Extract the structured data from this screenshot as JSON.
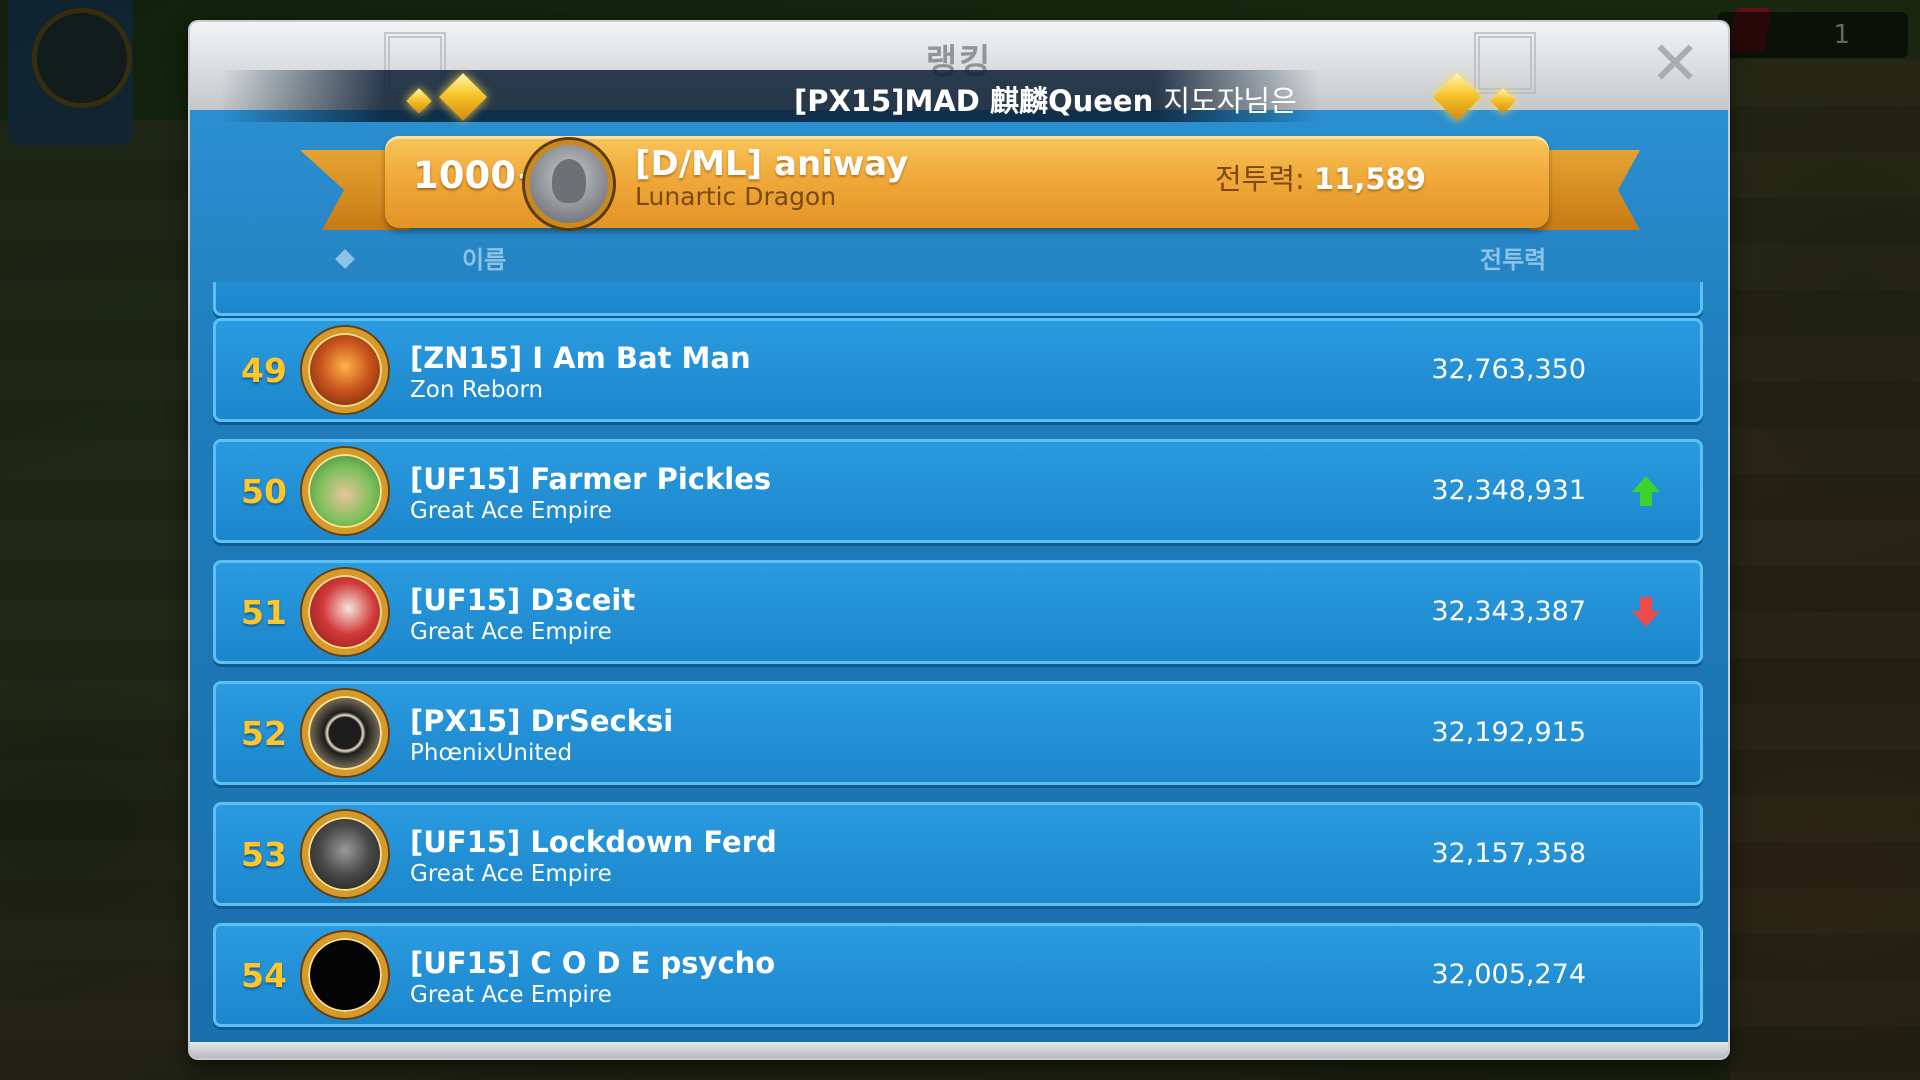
{
  "window": {
    "title": "랭킹"
  },
  "hud": {
    "counter": "1"
  },
  "announcement": {
    "text": "[PX15]MAD 麒麟Queen",
    "suffix": "지도자님은"
  },
  "my_entry": {
    "rank": "1000+",
    "name": "[D/ML] aniway",
    "alliance": "Lunartic Dragon",
    "power_label": "전투력: ",
    "power_value": "11,589"
  },
  "columns": {
    "name": "이름",
    "power": "전투력"
  },
  "rows": [
    {
      "rank": "49",
      "name": "[ZN15] I Am Bat Man",
      "alliance": "Zon Reborn",
      "power": "32,763,350",
      "trend": "none",
      "avatar": "dragon-emblem",
      "color": "#c8541c"
    },
    {
      "rank": "50",
      "name": "[UF15] Farmer Pickles",
      "alliance": "Great Ace Empire",
      "power": "32,348,931",
      "trend": "up",
      "avatar": "farmer-character",
      "color": "#7cbf5a"
    },
    {
      "rank": "51",
      "name": "[UF15] D3ceit",
      "alliance": "Great Ace Empire",
      "power": "32,343,387",
      "trend": "down",
      "avatar": "red-hood-character",
      "color": "#d23a3a"
    },
    {
      "rank": "52",
      "name": "[PX15] DrSecksi",
      "alliance": "PhœnixUnited",
      "power": "32,192,915",
      "trend": "none",
      "avatar": "pentagram-seal",
      "color": "#1c1c1c"
    },
    {
      "rank": "53",
      "name": "[UF15] Lockdown Ferd",
      "alliance": "Great Ace Empire",
      "power": "32,157,358",
      "trend": "none",
      "avatar": "lion-mask",
      "color": "#4a4a4a"
    },
    {
      "rank": "54",
      "name": "[UF15] C O D E psycho",
      "alliance": "Great Ace Empire",
      "power": "32,005,274",
      "trend": "none",
      "avatar": "black-circle",
      "color": "#050505"
    }
  ],
  "colors": {
    "rank_gold": "#ffc52b",
    "trend_up": "#3bd42c",
    "trend_down": "#f14a4a",
    "row_blue": "#1c86cc"
  }
}
